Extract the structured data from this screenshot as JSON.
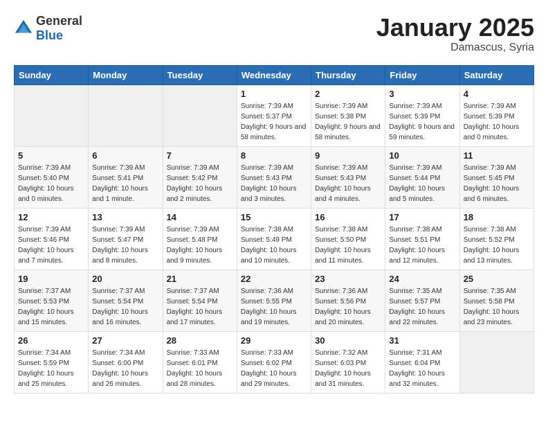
{
  "logo": {
    "general": "General",
    "blue": "Blue"
  },
  "header": {
    "month": "January 2025",
    "location": "Damascus, Syria"
  },
  "weekdays": [
    "Sunday",
    "Monday",
    "Tuesday",
    "Wednesday",
    "Thursday",
    "Friday",
    "Saturday"
  ],
  "weeks": [
    [
      {
        "day": "",
        "info": ""
      },
      {
        "day": "",
        "info": ""
      },
      {
        "day": "",
        "info": ""
      },
      {
        "day": "1",
        "info": "Sunrise: 7:39 AM\nSunset: 5:37 PM\nDaylight: 9 hours\nand 58 minutes."
      },
      {
        "day": "2",
        "info": "Sunrise: 7:39 AM\nSunset: 5:38 PM\nDaylight: 9 hours\nand 58 minutes."
      },
      {
        "day": "3",
        "info": "Sunrise: 7:39 AM\nSunset: 5:39 PM\nDaylight: 9 hours\nand 59 minutes."
      },
      {
        "day": "4",
        "info": "Sunrise: 7:39 AM\nSunset: 5:39 PM\nDaylight: 10 hours\nand 0 minutes."
      }
    ],
    [
      {
        "day": "5",
        "info": "Sunrise: 7:39 AM\nSunset: 5:40 PM\nDaylight: 10 hours\nand 0 minutes."
      },
      {
        "day": "6",
        "info": "Sunrise: 7:39 AM\nSunset: 5:41 PM\nDaylight: 10 hours\nand 1 minute."
      },
      {
        "day": "7",
        "info": "Sunrise: 7:39 AM\nSunset: 5:42 PM\nDaylight: 10 hours\nand 2 minutes."
      },
      {
        "day": "8",
        "info": "Sunrise: 7:39 AM\nSunset: 5:43 PM\nDaylight: 10 hours\nand 3 minutes."
      },
      {
        "day": "9",
        "info": "Sunrise: 7:39 AM\nSunset: 5:43 PM\nDaylight: 10 hours\nand 4 minutes."
      },
      {
        "day": "10",
        "info": "Sunrise: 7:39 AM\nSunset: 5:44 PM\nDaylight: 10 hours\nand 5 minutes."
      },
      {
        "day": "11",
        "info": "Sunrise: 7:39 AM\nSunset: 5:45 PM\nDaylight: 10 hours\nand 6 minutes."
      }
    ],
    [
      {
        "day": "12",
        "info": "Sunrise: 7:39 AM\nSunset: 5:46 PM\nDaylight: 10 hours\nand 7 minutes."
      },
      {
        "day": "13",
        "info": "Sunrise: 7:39 AM\nSunset: 5:47 PM\nDaylight: 10 hours\nand 8 minutes."
      },
      {
        "day": "14",
        "info": "Sunrise: 7:39 AM\nSunset: 5:48 PM\nDaylight: 10 hours\nand 9 minutes."
      },
      {
        "day": "15",
        "info": "Sunrise: 7:38 AM\nSunset: 5:49 PM\nDaylight: 10 hours\nand 10 minutes."
      },
      {
        "day": "16",
        "info": "Sunrise: 7:38 AM\nSunset: 5:50 PM\nDaylight: 10 hours\nand 11 minutes."
      },
      {
        "day": "17",
        "info": "Sunrise: 7:38 AM\nSunset: 5:51 PM\nDaylight: 10 hours\nand 12 minutes."
      },
      {
        "day": "18",
        "info": "Sunrise: 7:38 AM\nSunset: 5:52 PM\nDaylight: 10 hours\nand 13 minutes."
      }
    ],
    [
      {
        "day": "19",
        "info": "Sunrise: 7:37 AM\nSunset: 5:53 PM\nDaylight: 10 hours\nand 15 minutes."
      },
      {
        "day": "20",
        "info": "Sunrise: 7:37 AM\nSunset: 5:54 PM\nDaylight: 10 hours\nand 16 minutes."
      },
      {
        "day": "21",
        "info": "Sunrise: 7:37 AM\nSunset: 5:54 PM\nDaylight: 10 hours\nand 17 minutes."
      },
      {
        "day": "22",
        "info": "Sunrise: 7:36 AM\nSunset: 5:55 PM\nDaylight: 10 hours\nand 19 minutes."
      },
      {
        "day": "23",
        "info": "Sunrise: 7:36 AM\nSunset: 5:56 PM\nDaylight: 10 hours\nand 20 minutes."
      },
      {
        "day": "24",
        "info": "Sunrise: 7:35 AM\nSunset: 5:57 PM\nDaylight: 10 hours\nand 22 minutes."
      },
      {
        "day": "25",
        "info": "Sunrise: 7:35 AM\nSunset: 5:58 PM\nDaylight: 10 hours\nand 23 minutes."
      }
    ],
    [
      {
        "day": "26",
        "info": "Sunrise: 7:34 AM\nSunset: 5:59 PM\nDaylight: 10 hours\nand 25 minutes."
      },
      {
        "day": "27",
        "info": "Sunrise: 7:34 AM\nSunset: 6:00 PM\nDaylight: 10 hours\nand 26 minutes."
      },
      {
        "day": "28",
        "info": "Sunrise: 7:33 AM\nSunset: 6:01 PM\nDaylight: 10 hours\nand 28 minutes."
      },
      {
        "day": "29",
        "info": "Sunrise: 7:33 AM\nSunset: 6:02 PM\nDaylight: 10 hours\nand 29 minutes."
      },
      {
        "day": "30",
        "info": "Sunrise: 7:32 AM\nSunset: 6:03 PM\nDaylight: 10 hours\nand 31 minutes."
      },
      {
        "day": "31",
        "info": "Sunrise: 7:31 AM\nSunset: 6:04 PM\nDaylight: 10 hours\nand 32 minutes."
      },
      {
        "day": "",
        "info": ""
      }
    ]
  ]
}
